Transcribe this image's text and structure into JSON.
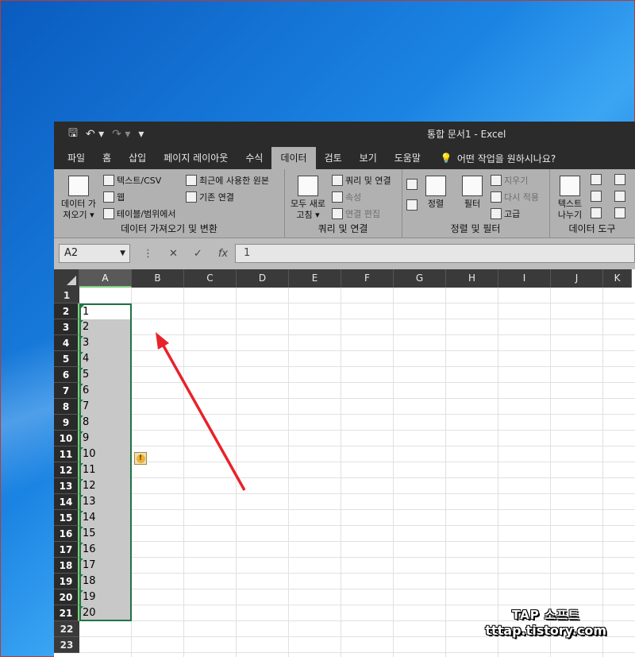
{
  "window": {
    "title": "통합 문서1  -  Excel"
  },
  "qat": {
    "save_icon": "save-icon",
    "undo_icon": "undo-icon",
    "redo_icon": "redo-icon",
    "customize_icon": "customize-qat-icon"
  },
  "tabs": [
    "파일",
    "홈",
    "삽입",
    "페이지 레이아웃",
    "수식",
    "데이터",
    "검토",
    "보기",
    "도움말"
  ],
  "active_tab": "데이터",
  "tell_me": "어떤 작업을 원하시나요?",
  "ribbon": {
    "get_data": {
      "big_label_1": "데이터 가",
      "big_label_2": "져오기 ▾",
      "text_csv": "텍스트/CSV",
      "web": "웹",
      "table_range": "테이블/범위에서",
      "recent_sources": "최근에 사용한 원본",
      "existing_conn": "기존 연결",
      "group_label": "데이터 가져오기 및 변환"
    },
    "queries": {
      "refresh_1": "모두 새로",
      "refresh_2": "고침 ▾",
      "queries_conn": "쿼리 및 연결",
      "properties": "속성",
      "edit_links": "연결 편집",
      "group_label": "쿼리 및 연결"
    },
    "sort_filter": {
      "sort": "정렬",
      "filter": "필터",
      "clear": "지우기",
      "reapply": "다시 적용",
      "advanced": "고급",
      "group_label": "정렬 및 필터"
    },
    "data_tools": {
      "text_to_cols_1": "텍스트",
      "text_to_cols_2": "나누기",
      "group_label": "데이터 도구"
    }
  },
  "formula_bar": {
    "name_box": "A2",
    "formula": "1",
    "cancel": "✕",
    "enter": "✓",
    "fx": "fx",
    "dots": "⋮"
  },
  "columns": [
    "A",
    "B",
    "C",
    "D",
    "E",
    "F",
    "G",
    "H",
    "I",
    "J",
    "K"
  ],
  "rows": [
    "1",
    "2",
    "3",
    "4",
    "5",
    "6",
    "7",
    "8",
    "9",
    "10",
    "11",
    "12",
    "13",
    "14",
    "15",
    "16",
    "17",
    "18",
    "19",
    "20",
    "21",
    "22",
    "23"
  ],
  "cells_A": [
    "",
    "1",
    "2",
    "3",
    "4",
    "5",
    "6",
    "7",
    "8",
    "9",
    "10",
    "11",
    "12",
    "13",
    "14",
    "15",
    "16",
    "17",
    "18",
    "19",
    "20",
    "",
    ""
  ],
  "watermark": {
    "line1": "TAP 소프트",
    "line2": "tttap.tistory.com"
  },
  "colors": {
    "accent": "#217346",
    "arrow": "#e8222b"
  }
}
